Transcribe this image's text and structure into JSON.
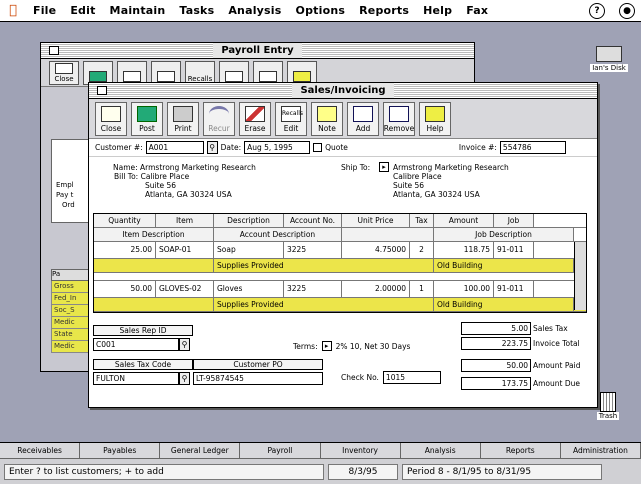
{
  "menubar": {
    "items": [
      "File",
      "Edit",
      "Maintain",
      "Tasks",
      "Analysis",
      "Options",
      "Reports",
      "Help",
      "Fax"
    ]
  },
  "desktop": {
    "disk_label": "Ian's Disk",
    "trash_label": "Trash"
  },
  "back_window": {
    "title": "Payroll Entry",
    "toolbar": [
      "Close",
      "",
      "",
      "",
      "Recalls",
      "",
      ""
    ],
    "left_labels": [
      "Empl",
      "Pay t",
      "Ord"
    ],
    "side_header": "Pa",
    "side_rows": [
      "Gross",
      "Fed_In",
      "Soc_S",
      "Medic",
      "State",
      "Medic"
    ]
  },
  "main_window": {
    "title": "Sales/Invoicing",
    "toolbar": [
      "Close",
      "Post",
      "Print",
      "Recur",
      "Erase",
      "Edit",
      "Note",
      "Add",
      "Remove",
      "Help"
    ],
    "toolbar_recalls": "Recalls",
    "customer_label": "Customer #:",
    "customer_value": "A001",
    "date_label": "Date:",
    "date_value": "Aug 5, 1995",
    "quote_label": "Quote",
    "invoice_label": "Invoice #:",
    "invoice_value": "554786",
    "bill_name": "Name: Armstrong Marketing Research",
    "bill_to": "Bill To: Calibre Place",
    "bill_line2": "Suite 56",
    "bill_line3": "Atlanta, GA 30324 USA",
    "ship_to_label": "Ship To:",
    "ship_name": "Armstrong Marketing Research",
    "ship_line1": "Calibre Place",
    "ship_line2": "Suite 56",
    "ship_line3": "Atlanta, GA 30324 USA",
    "grid": {
      "headers": [
        "Quantity",
        "Item",
        "Description",
        "Account No.",
        "Unit Price",
        "Tax",
        "Amount",
        "Job"
      ],
      "subheaders": [
        "Item Description",
        "Account Description",
        "Job Description"
      ],
      "rows": [
        {
          "qty": "25.00",
          "item": "SOAP-01",
          "desc": "Soap",
          "acct": "3225",
          "price": "4.75000",
          "tax": "2",
          "amount": "118.75",
          "job": "91-011",
          "acct_desc": "Supplies Provided",
          "job_desc": "Old Building"
        },
        {
          "qty": "50.00",
          "item": "GLOVES-02",
          "desc": "Gloves",
          "acct": "3225",
          "price": "2.00000",
          "tax": "1",
          "amount": "100.00",
          "job": "91-011",
          "acct_desc": "Supplies Provided",
          "job_desc": "Old Building"
        }
      ]
    },
    "sales_rep_label": "Sales Rep ID",
    "sales_rep_value": "C001",
    "sales_tax_label": "Sales Tax Code",
    "sales_tax_value": "FULTON",
    "customer_po_label": "Customer PO",
    "customer_po_value": "LT-95874545",
    "terms_label": "Terms:",
    "terms_value": "2% 10, Net 30 Days",
    "check_label": "Check No.",
    "check_value": "1015",
    "totals": [
      {
        "value": "5.00",
        "label": "Sales Tax"
      },
      {
        "value": "223.75",
        "label": "Invoice Total"
      },
      {
        "value": "50.00",
        "label": "Amount Paid"
      },
      {
        "value": "173.75",
        "label": "Amount Due"
      }
    ]
  },
  "tabs": [
    "Receivables",
    "Payables",
    "General Ledger",
    "Payroll",
    "Inventory",
    "Analysis",
    "Reports",
    "Administration"
  ],
  "status": {
    "hint": "Enter ? to list customers; + to add",
    "date": "8/3/95",
    "period": "Period 8 - 8/1/95 to 8/31/95"
  }
}
